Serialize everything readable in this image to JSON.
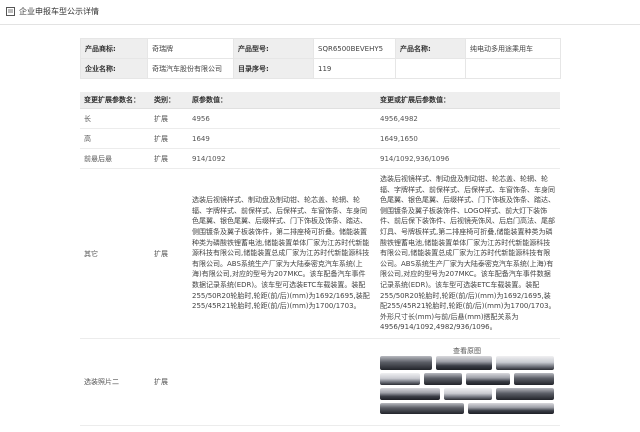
{
  "header": {
    "title": "企业申报车型公示详情",
    "icon": "document-icon"
  },
  "info": {
    "brand_label": "产品商标:",
    "brand_value": "奇瑞牌",
    "model_label": "产品型号:",
    "model_value": "SQR6500BEVEHY5",
    "name_label": "产品名称:",
    "name_value": "纯电动多用途乘用车",
    "company_label": "企业名称:",
    "company_value": "奇瑞汽车股份有限公司",
    "catalog_label": "目录序号:",
    "catalog_value": "119"
  },
  "changes": {
    "headers": [
      "变更扩展参数名：",
      "类别：",
      "原参数值：",
      "变更或扩展后参数值："
    ],
    "rows": [
      {
        "name": "长",
        "category": "扩展",
        "original": "4956",
        "changed": "4956,4982"
      },
      {
        "name": "高",
        "category": "扩展",
        "original": "1649",
        "changed": "1649,1650"
      },
      {
        "name": "前悬后悬",
        "category": "扩展",
        "original": "914/1092",
        "changed": "914/1092,936/1096"
      },
      {
        "name": "其它",
        "category": "扩展",
        "original": "选装后视镜样式、制动盘及制动钳、轮芯盖、轮辋、轮辐、字牌样式、前保样式、后保样式、车窗饰条、车身同色尾翼、银色尾翼、后缀样式、门下饰板及饰条、踏达、侧围镀条及翼子板装饰件，第二排座椅可折叠。储能装置种类为磷酸铁锂蓄电池,储能装置单体厂家为江苏时代新能源科技有限公司,储能装置总成厂家为江苏时代新能源科技有限公司。ABS系统生产厂家为大陆泰密克汽车系统(上海)有限公司,对应的型号为207MKC。该车配备汽车事件数据记录系统(EDR)。该车型可选装ETC车载装置。装配255/50R20轮胎时,轮距(前/后)(mm)为1692/1695,装配255/45R21轮胎时,轮距(前/后)(mm)为1700/1703。",
        "changed": "选装后视镜样式、制动盘及制动钳、轮芯盖、轮辋、轮辐、字牌样式、前保样式、后保样式、车窗饰条、车身同色尾翼、银色尾翼、后缀样式、门下饰板及饰条、踏达、侧围镀条及翼子板装饰件、LOGO样式、前大灯下装饰件、前后保下装饰件、后视镜壳饰风、后启门高法、尾部灯具、号牌板样式,第二排座椅可折叠,储能装置种类为磷酸铁锂蓄电池,储能装置单体厂家为江苏时代新能源科技有限公司,储能装置总成厂家为江苏时代新能源科技有限公司。ABS系统生产厂家为大陆泰密克汽车系统(上海)有限公司,对应的型号为207MKC。该车配备汽车事件数据记录系统(EDR)。该车型可选装ETC车载装置。装配255/50R20轮胎时,轮距(前/后)(mm)为1692/1695,装配255/45R21轮胎时,轮距(前/后)(mm)为1700/1703。外形尺寸长(mm)与前/后悬(mm)搭配关系为4956/914/1092,4982/936/1096。"
      },
      {
        "name": "选装照片二",
        "category": "扩展",
        "original": "",
        "changed_label": "查看原图"
      }
    ]
  }
}
